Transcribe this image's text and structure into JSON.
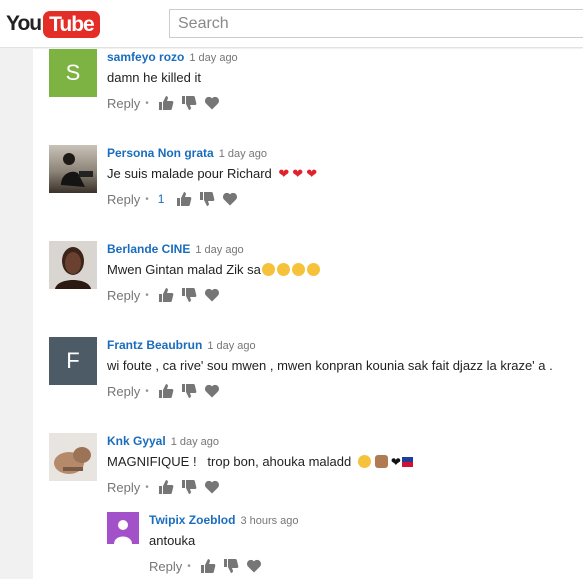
{
  "header": {
    "logo_part1": "You",
    "logo_part2": "Tube",
    "search_placeholder": "Search"
  },
  "colors": {
    "brand_red": "#e52d27",
    "author_blue": "#1a6dbd",
    "avatar_green": "#7cb342",
    "avatar_gray": "#4d5b66",
    "avatar_purple": "#a251c9"
  },
  "comments": [
    {
      "author": "samfeyo rozo",
      "time": "1 day ago",
      "text": "damn he killed it",
      "reply_label": "Reply",
      "avatar_letter": "S",
      "avatar_type": "letter",
      "avatar_color": "#7cb342"
    },
    {
      "author": "Persona Non grata",
      "time": "1 day ago",
      "text": "Je suis malade pour Richard",
      "reply_label": "Reply",
      "like_count": "1",
      "avatar_type": "photo",
      "emoji": [
        "red-heart",
        "red-heart",
        "red-heart"
      ]
    },
    {
      "author": "Berlande CINE",
      "time": "1 day ago",
      "text": "Mwen Gintan malad Zik sa",
      "reply_label": "Reply",
      "avatar_type": "photo",
      "emoji": [
        "heart-eyes-face",
        "kissing-face",
        "kissing-heart-face",
        "kissing-closed-eyes-face"
      ]
    },
    {
      "author": "Frantz Beaubrun",
      "time": "1 day ago",
      "text": "wi foute , ca rive' sou mwen , mwen konpran kounia sak fait djazz la kraze' a .",
      "reply_label": "Reply",
      "avatar_letter": "F",
      "avatar_type": "letter",
      "avatar_color": "#4d5b66"
    },
    {
      "author": "Knk Gyyal",
      "time": "1 day ago",
      "text": "MAGNIFIQUE !   trop bon, ahouka maladd",
      "reply_label": "Reply",
      "avatar_type": "photo",
      "emoji": [
        "heart-eyes-face",
        "victory-hand",
        "black-heart",
        "haiti-flag"
      ]
    },
    {
      "author": "Twipix Zoeblod",
      "time": "3 hours ago",
      "text": "antouka",
      "reply_label": "Reply",
      "avatar_type": "person-silhouette",
      "avatar_color": "#a251c9",
      "is_reply": true
    }
  ]
}
